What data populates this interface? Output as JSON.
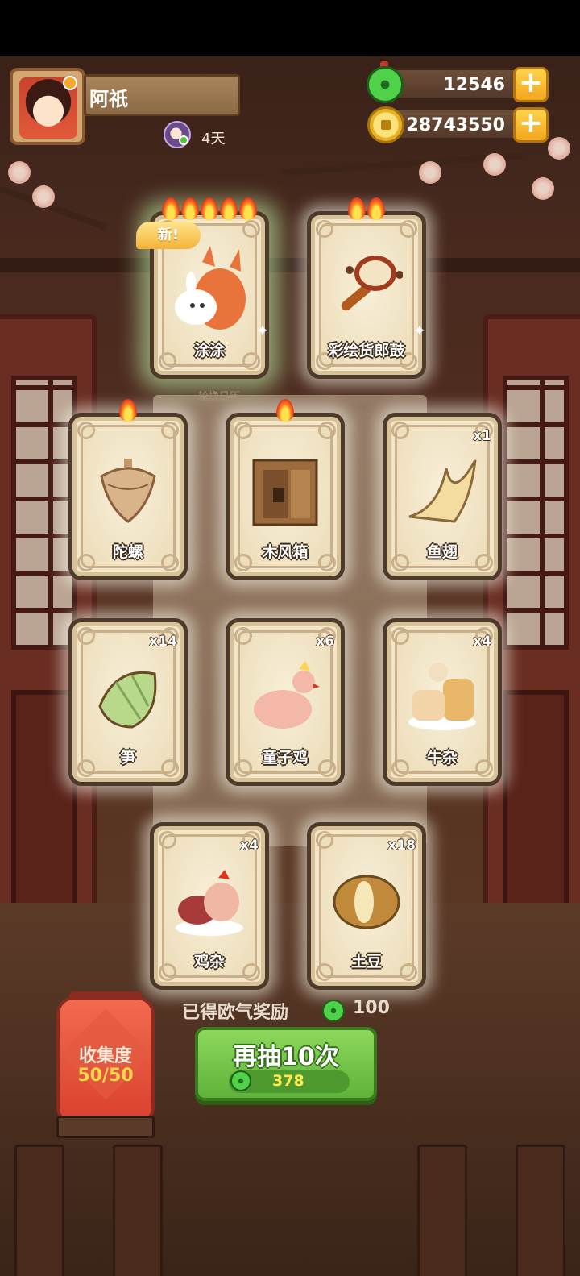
{
  "player": {
    "name": "阿祇",
    "days_label": "4天"
  },
  "currency": {
    "jade": "12546",
    "coins": "28743550",
    "plus_symbol": "+"
  },
  "new_tag": "新!",
  "calendar_label": "轮换日历",
  "cards": [
    {
      "name": "涂涂",
      "flames": 5,
      "quantity": "",
      "is_new": true,
      "art": "fox-and-rabbit"
    },
    {
      "name": "彩绘货郎鼓",
      "flames": 2,
      "quantity": "",
      "is_new": false,
      "art": "rattle-drum"
    },
    {
      "name": "陀螺",
      "flames": 1,
      "quantity": "",
      "is_new": false,
      "art": "spinning-top"
    },
    {
      "name": "木风箱",
      "flames": 1,
      "quantity": "",
      "is_new": false,
      "art": "bellows"
    },
    {
      "name": "鱼翅",
      "flames": 0,
      "quantity": "x1",
      "is_new": false,
      "art": "shark-fin"
    },
    {
      "name": "笋",
      "flames": 0,
      "quantity": "x14",
      "is_new": false,
      "art": "bamboo-shoot"
    },
    {
      "name": "童子鸡",
      "flames": 0,
      "quantity": "x6",
      "is_new": false,
      "art": "chicken"
    },
    {
      "name": "牛杂",
      "flames": 0,
      "quantity": "x4",
      "is_new": false,
      "art": "beef-offal"
    },
    {
      "name": "鸡杂",
      "flames": 0,
      "quantity": "x4",
      "is_new": false,
      "art": "chicken-giblets"
    },
    {
      "name": "土豆",
      "flames": 0,
      "quantity": "x18",
      "is_new": false,
      "art": "potato"
    }
  ],
  "reward": {
    "label": "已得欧气奖励",
    "value": "100"
  },
  "collection": {
    "label": "收集度",
    "count": "50/50"
  },
  "draw_button": {
    "label": "再抽10次",
    "cost": "378"
  },
  "colors": {
    "accent_green": "#5fb23a",
    "gold": "#f2a51c",
    "lantern_red": "#d9412e"
  }
}
